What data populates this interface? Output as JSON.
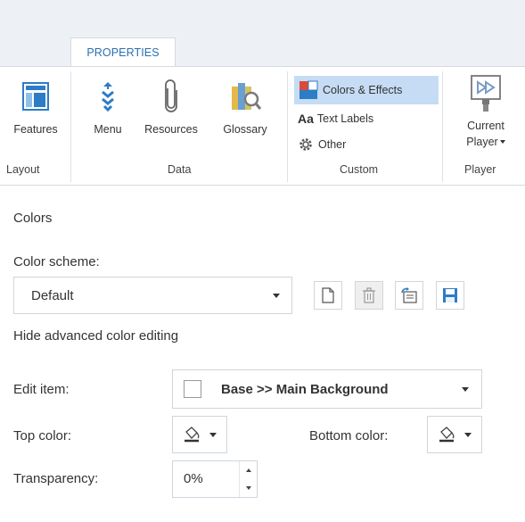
{
  "ribbon": {
    "tab": "PROPERTIES",
    "groups": {
      "layout": {
        "label": "Layout",
        "features": "Features"
      },
      "data": {
        "label": "Data",
        "menu": "Menu",
        "resources": "Resources",
        "glossary": "Glossary"
      },
      "custom": {
        "label": "Custom",
        "colors_effects": "Colors & Effects",
        "text_labels": "Text Labels",
        "text_labels_prefix": "Aa",
        "other": "Other"
      },
      "player": {
        "label": "Player",
        "current_player_line1": "Current",
        "current_player_line2": "Player"
      }
    }
  },
  "colors": {
    "title": "Colors",
    "scheme_label": "Color scheme:",
    "scheme_value": "Default",
    "hide_advanced_link": "Hide advanced color editing",
    "edit_item_label": "Edit item:",
    "edit_item_value": "Base >> Main Background",
    "top_color_label": "Top color:",
    "bottom_color_label": "Bottom color:",
    "transparency_label": "Transparency:",
    "transparency_value": "0%"
  },
  "theme": {
    "accent": "#2a6eaf",
    "selected_bg": "#c5dcf4",
    "ribbon_bg": "#edf1f5"
  }
}
